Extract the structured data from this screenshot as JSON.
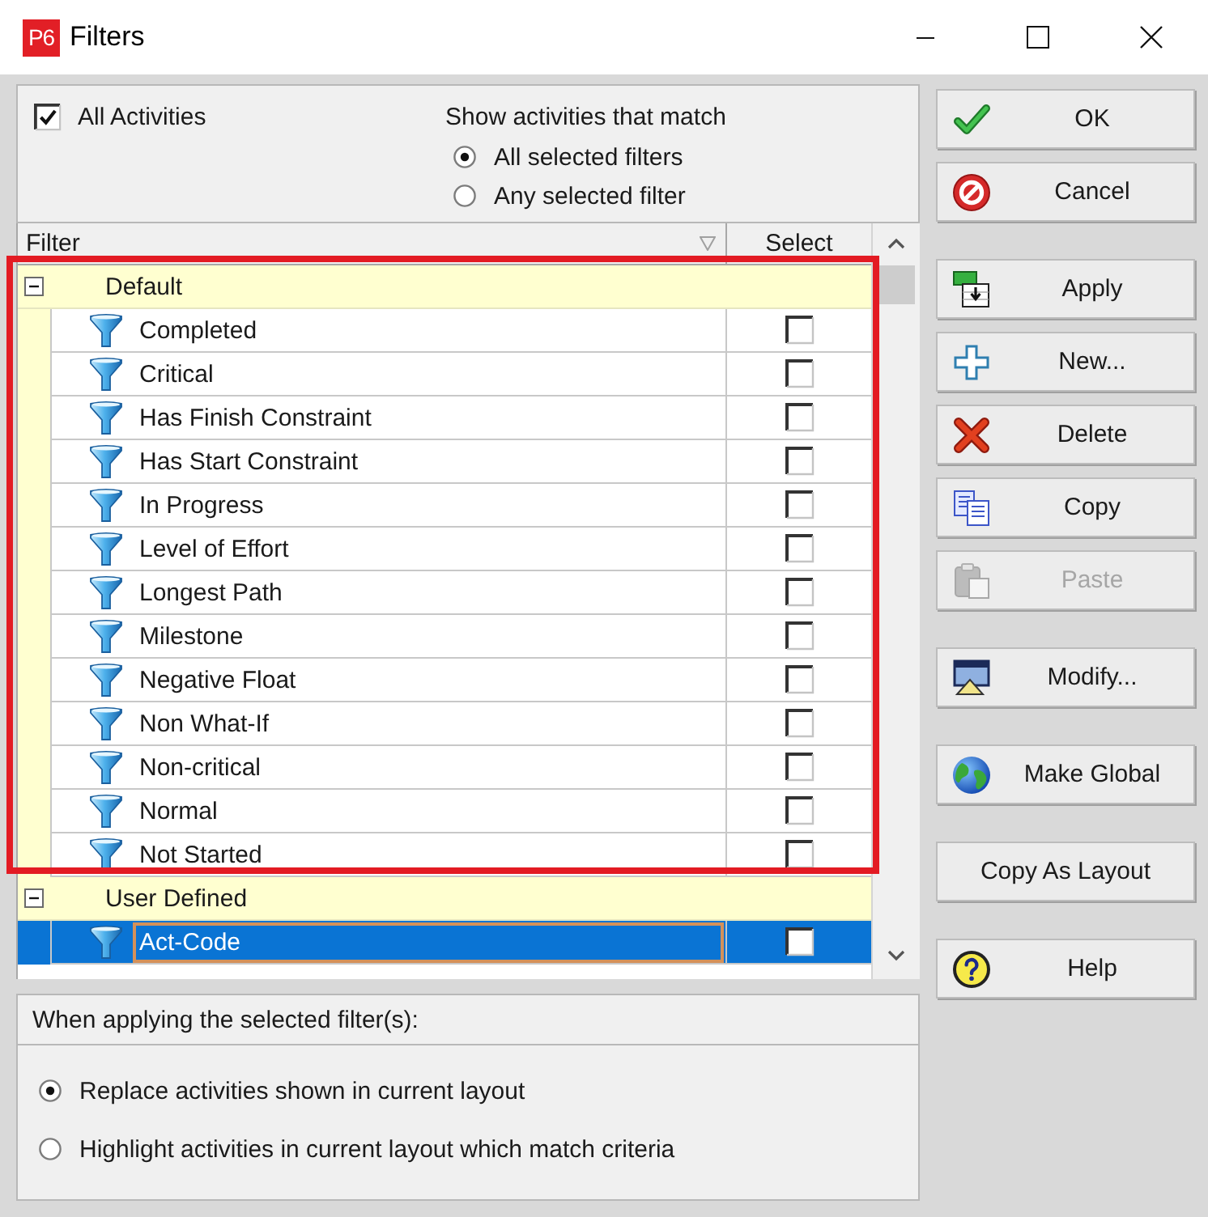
{
  "window": {
    "app_badge": "P6",
    "title": "Filters"
  },
  "all_activities": {
    "label": "All Activities",
    "checked": true
  },
  "match": {
    "label": "Show activities that match",
    "options": [
      {
        "label": "All selected filters",
        "selected": true
      },
      {
        "label": "Any selected filter",
        "selected": false
      }
    ]
  },
  "filter_table": {
    "columns": [
      "Filter",
      "Select"
    ],
    "groups": [
      {
        "label": "Default",
        "expanded": true,
        "highlighted": true,
        "rows": [
          {
            "label": "Completed",
            "checked": false,
            "selected": false
          },
          {
            "label": "Critical",
            "checked": false,
            "selected": false
          },
          {
            "label": "Has Finish Constraint",
            "checked": false,
            "selected": false
          },
          {
            "label": "Has Start Constraint",
            "checked": false,
            "selected": false
          },
          {
            "label": "In Progress",
            "checked": false,
            "selected": false
          },
          {
            "label": "Level of Effort",
            "checked": false,
            "selected": false
          },
          {
            "label": "Longest Path",
            "checked": false,
            "selected": false
          },
          {
            "label": "Milestone",
            "checked": false,
            "selected": false
          },
          {
            "label": "Negative Float",
            "checked": false,
            "selected": false
          },
          {
            "label": "Non What-If",
            "checked": false,
            "selected": false
          },
          {
            "label": "Non-critical",
            "checked": false,
            "selected": false
          },
          {
            "label": "Normal",
            "checked": false,
            "selected": false
          },
          {
            "label": "Not Started",
            "checked": false,
            "selected": false
          }
        ]
      },
      {
        "label": "User Defined",
        "expanded": true,
        "highlighted": false,
        "rows": [
          {
            "label": "Act-Code",
            "checked": false,
            "selected": true
          }
        ]
      }
    ]
  },
  "button_groups": [
    [
      {
        "kind": "ok",
        "label": "OK",
        "disabled": false
      },
      {
        "kind": "cancel",
        "label": "Cancel",
        "disabled": false
      }
    ],
    [
      {
        "kind": "apply",
        "label": "Apply",
        "disabled": false
      },
      {
        "kind": "new",
        "label": "New...",
        "disabled": false
      },
      {
        "kind": "delete",
        "label": "Delete",
        "disabled": false
      },
      {
        "kind": "copy",
        "label": "Copy",
        "disabled": false
      },
      {
        "kind": "paste",
        "label": "Paste",
        "disabled": true
      }
    ],
    [
      {
        "kind": "modify",
        "label": "Modify...",
        "disabled": false
      }
    ],
    [
      {
        "kind": "global",
        "label": "Make Global",
        "disabled": false
      }
    ],
    [
      {
        "kind": "layout",
        "label": "Copy As Layout",
        "disabled": false
      }
    ],
    [
      {
        "kind": "help",
        "label": "Help",
        "disabled": false
      }
    ]
  ],
  "apply_options": {
    "label": "When applying the selected filter(s):",
    "options": [
      {
        "label": "Replace activities shown in current layout",
        "selected": true
      },
      {
        "label": "Highlight activities in current layout which match criteria",
        "selected": false
      }
    ]
  }
}
